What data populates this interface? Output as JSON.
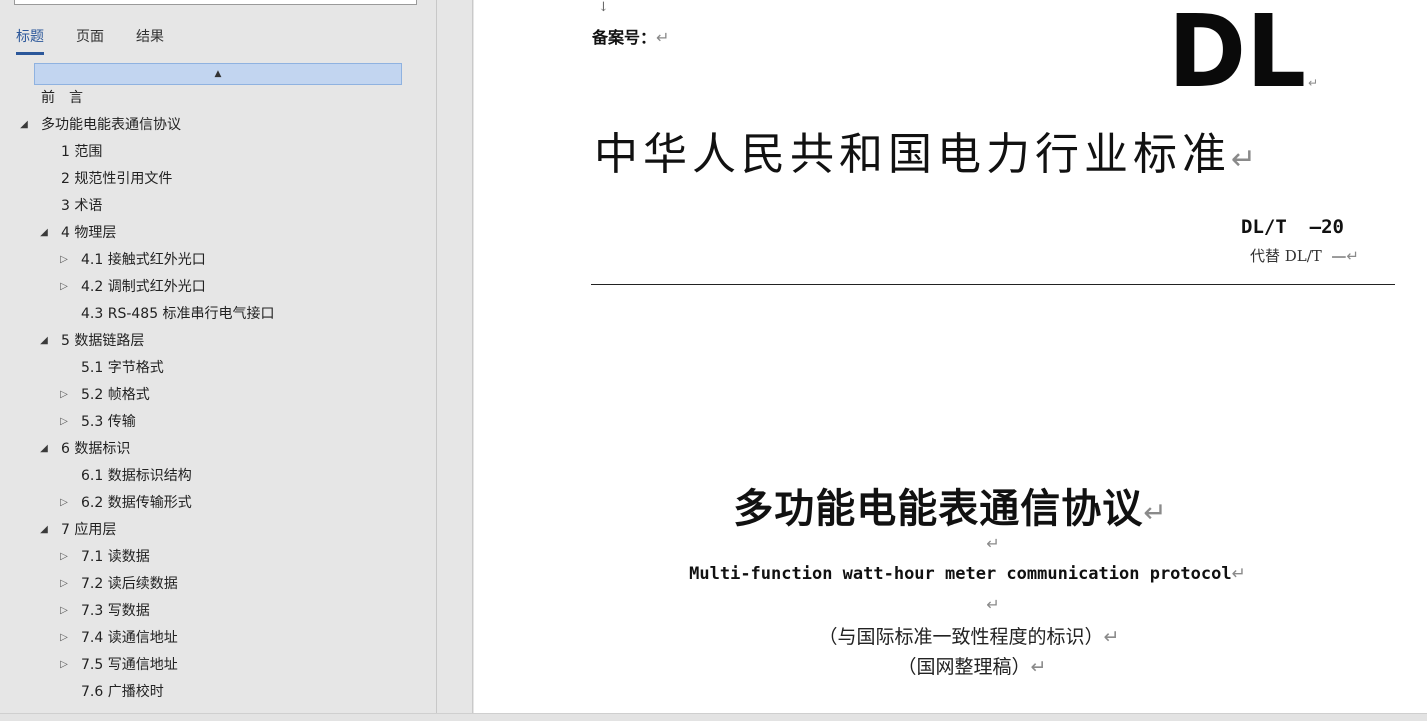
{
  "nav": {
    "tabs": [
      {
        "label": "标题",
        "active": true
      },
      {
        "label": "页面",
        "active": false
      },
      {
        "label": "结果",
        "active": false
      }
    ],
    "collapse_icon": "collapse-up-icon",
    "collapse_glyph": "▲",
    "headings": [
      {
        "label": "前　言",
        "level": 1,
        "arrow": ""
      },
      {
        "label": "多功能电能表通信协议",
        "level": 1,
        "arrow": "◢"
      },
      {
        "label": "1 范围",
        "level": 2,
        "arrow": ""
      },
      {
        "label": "2 规范性引用文件",
        "level": 2,
        "arrow": ""
      },
      {
        "label": "3 术语",
        "level": 2,
        "arrow": ""
      },
      {
        "label": "4 物理层",
        "level": 2,
        "arrow": "◢"
      },
      {
        "label": "4.1 接触式红外光口",
        "level": 3,
        "arrow": "▷"
      },
      {
        "label": "4.2 调制式红外光口",
        "level": 3,
        "arrow": "▷"
      },
      {
        "label": "4.3 RS-485 标准串行电气接口",
        "level": 3,
        "arrow": ""
      },
      {
        "label": "5 数据链路层",
        "level": 2,
        "arrow": "◢"
      },
      {
        "label": "5.1 字节格式",
        "level": 3,
        "arrow": ""
      },
      {
        "label": "5.2 帧格式",
        "level": 3,
        "arrow": "▷"
      },
      {
        "label": "5.3 传输",
        "level": 3,
        "arrow": "▷"
      },
      {
        "label": "6 数据标识",
        "level": 2,
        "arrow": "◢"
      },
      {
        "label": "6.1 数据标识结构",
        "level": 3,
        "arrow": ""
      },
      {
        "label": "6.2 数据传输形式",
        "level": 3,
        "arrow": "▷"
      },
      {
        "label": "7 应用层",
        "level": 2,
        "arrow": "◢"
      },
      {
        "label": "7.1 读数据",
        "level": 3,
        "arrow": "▷"
      },
      {
        "label": "7.2 读后续数据",
        "level": 3,
        "arrow": "▷"
      },
      {
        "label": "7.3 写数据",
        "level": 3,
        "arrow": "▷"
      },
      {
        "label": "7.4 读通信地址",
        "level": 3,
        "arrow": "▷"
      },
      {
        "label": "7.5 写通信地址",
        "level": 3,
        "arrow": "▷"
      },
      {
        "label": "7.6 广播校时",
        "level": 3,
        "arrow": ""
      }
    ]
  },
  "document": {
    "top_arrow": "↓",
    "record_label": "备案号：",
    "logo_text": "DL",
    "std_title": "中华人民共和国电力行业标准",
    "std_code": "DL/T  —20",
    "replaces": "代替 DL/T  —",
    "doc_title": "多功能电能表通信协议",
    "en_title": "Multi-function watt-hour meter communication protocol",
    "note_1": "（与国际标准一致性程度的标识）",
    "note_2": "（国网整理稿）",
    "para_mark": "↵"
  },
  "colors": {
    "accent": "#2b579a",
    "collapse_bar": "#c2d5f0",
    "pane_bg": "#e6e6e6",
    "page_bg": "#ffffff"
  }
}
